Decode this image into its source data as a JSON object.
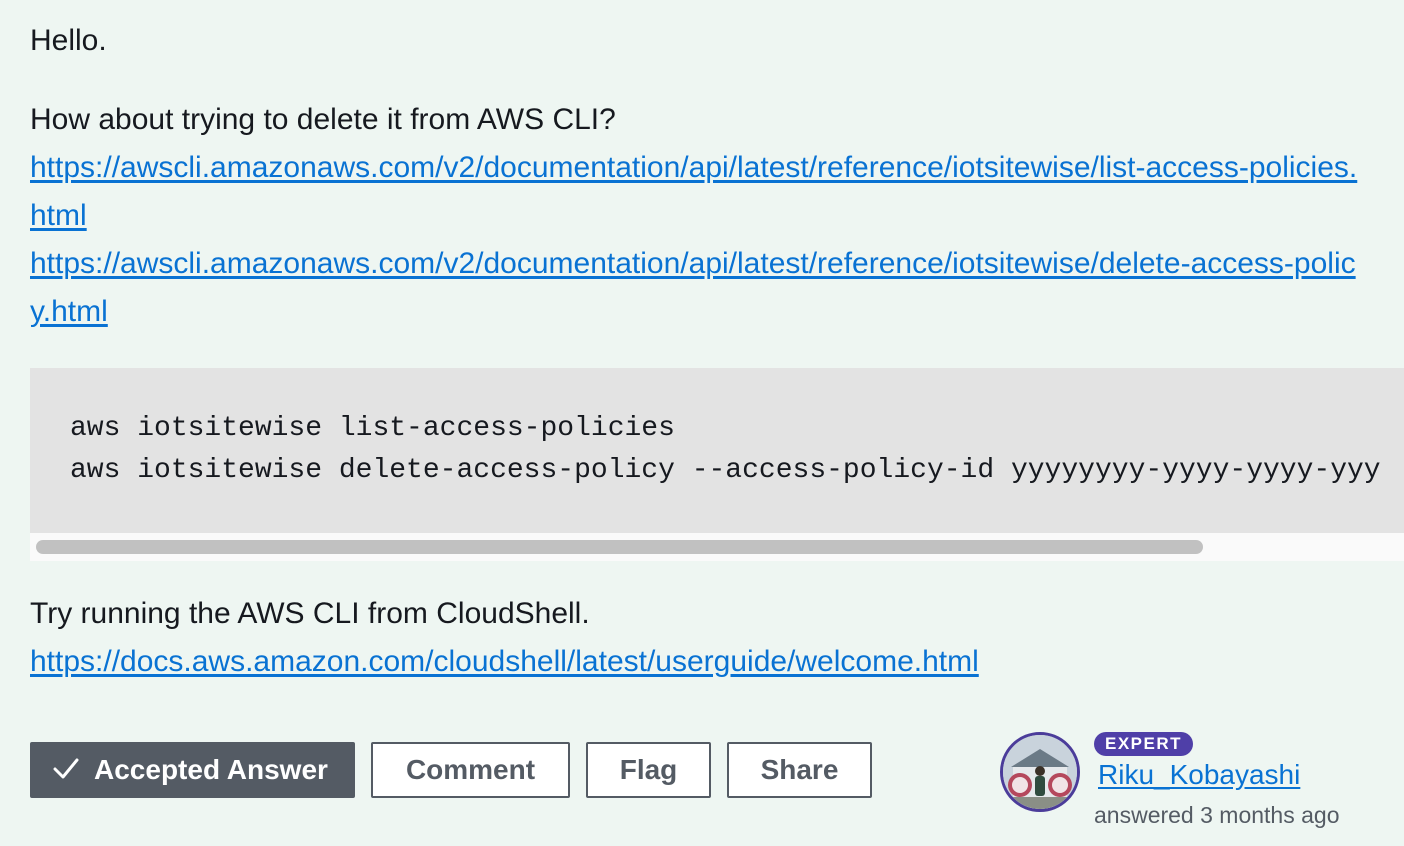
{
  "answer": {
    "greeting": "Hello.",
    "intro": "How about trying to delete it from AWS CLI?",
    "links": [
      "https://awscli.amazonaws.com/v2/documentation/api/latest/reference/iotsitewise/list-access-policies.html",
      "https://awscli.amazonaws.com/v2/documentation/api/latest/reference/iotsitewise/delete-access-policy.html"
    ],
    "code_lines": [
      "aws iotsitewise list-access-policies",
      "aws iotsitewise delete-access-policy --access-policy-id yyyyyyyy-yyyy-yyyy-yyy"
    ],
    "cloudshell_text": "Try running the AWS CLI from CloudShell.",
    "cloudshell_link": "https://docs.aws.amazon.com/cloudshell/latest/userguide/welcome.html"
  },
  "actions": {
    "accepted_label": "Accepted Answer",
    "comment_label": "Comment",
    "flag_label": "Flag",
    "share_label": "Share"
  },
  "author": {
    "badge": "EXPERT",
    "name": "Riku_Kobayashi",
    "answered": "answered 3 months ago"
  },
  "icons": {
    "accepted": "check-icon",
    "avatar": "user-avatar"
  },
  "colors": {
    "background": "#eef6f2",
    "link": "#0972d3",
    "button_dark": "#545b64",
    "badge": "#4f3fa8",
    "code_bg": "#e3e3e3"
  }
}
